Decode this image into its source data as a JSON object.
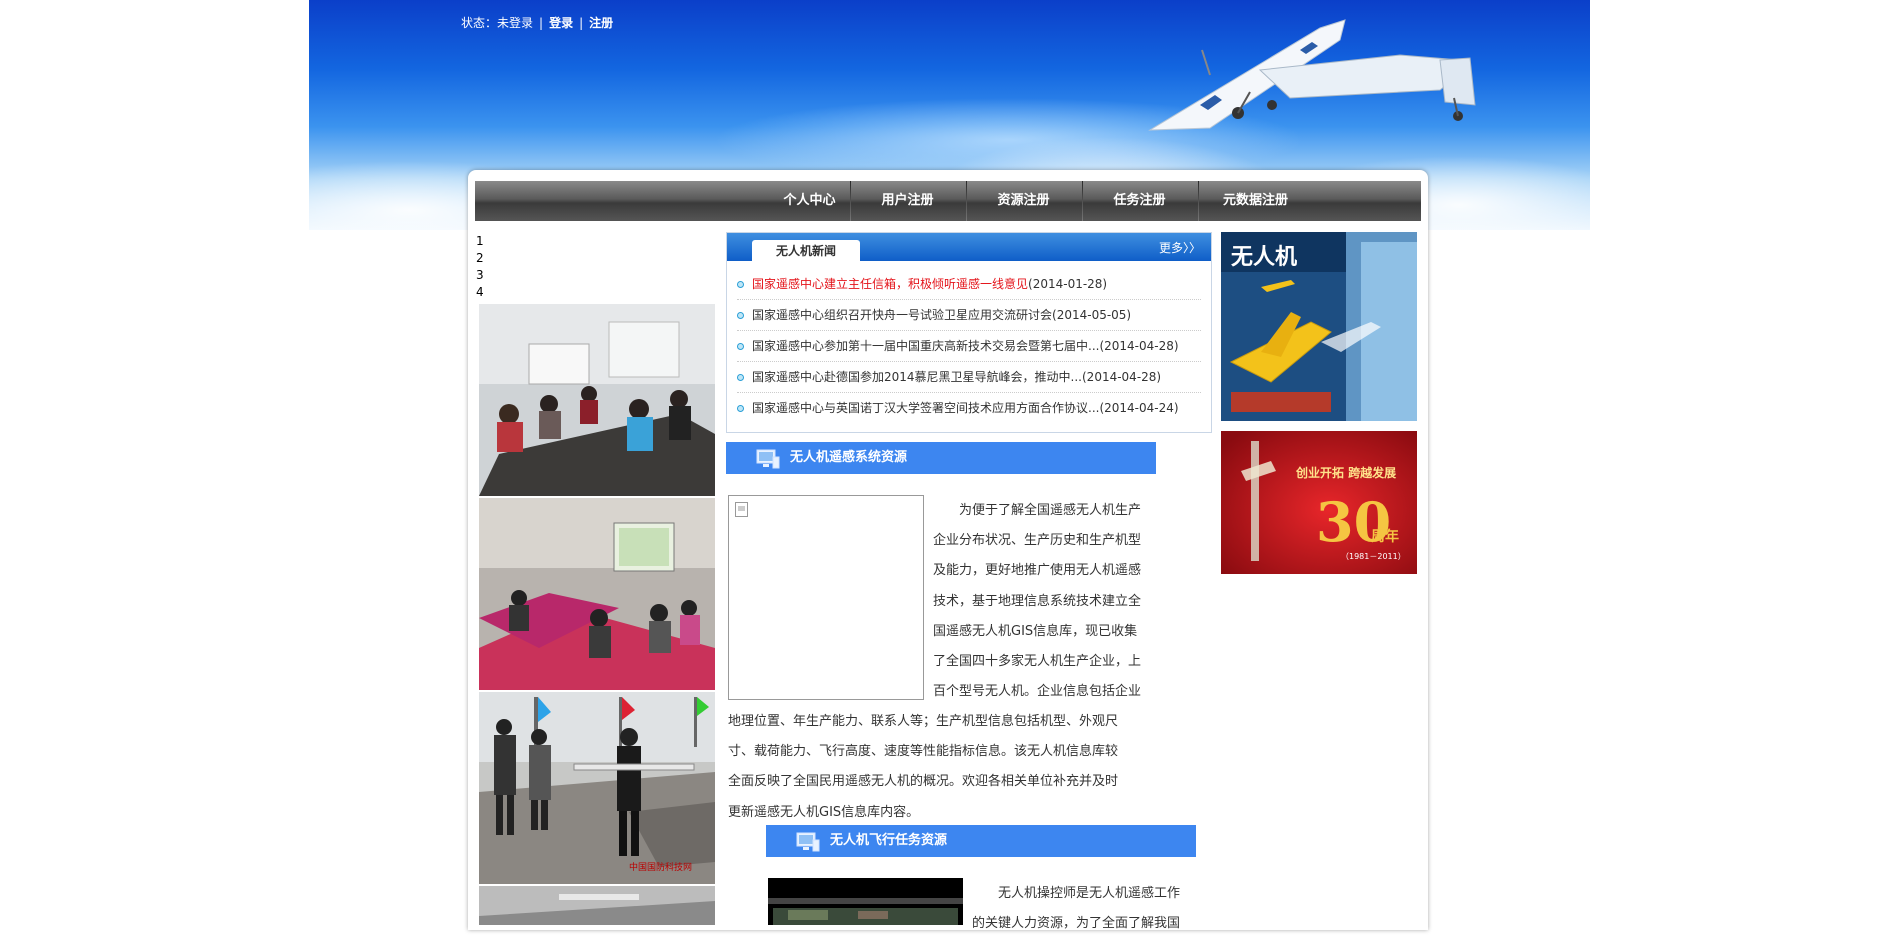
{
  "header": {
    "status_label": "状态：未登录",
    "login": "登录",
    "register": "注册"
  },
  "nav": {
    "items": [
      {
        "label": "个人中心"
      },
      {
        "label": "用户注册"
      },
      {
        "label": "资源注册"
      },
      {
        "label": "任务注册"
      },
      {
        "label": "元数据注册"
      }
    ]
  },
  "slider": {
    "numbers": [
      "1",
      "2",
      "3",
      "4"
    ]
  },
  "news": {
    "title": "无人机新闻",
    "more": "更多〉〉",
    "items": [
      {
        "title": "国家遥感中心建立主任信箱，积极倾听遥感一线意见",
        "date": "(2014-01-28)"
      },
      {
        "title": "国家遥感中心组织召开快舟一号试验卫星应用交流研讨会",
        "date": "(2014-05-05)"
      },
      {
        "title": "国家遥感中心参加第十一届中国重庆高新技术交易会暨第七届中...",
        "date": "(2014-04-28)"
      },
      {
        "title": "国家遥感中心赴德国参加2014慕尼黑卫星导航峰会，推动中...",
        "date": "(2014-04-28)"
      },
      {
        "title": "国家遥感中心与英国诺丁汉大学签署空间技术应用方面合作协议...",
        "date": "(2014-04-24)"
      }
    ]
  },
  "resources": {
    "title": "无人机遥感系统资源",
    "text_lines": [
      "　　为便于了解全国遥感无人机生产",
      "企业分布状况、生产历史和生产机型",
      "及能力，更好地推广使用无人机遥感",
      "技术，基于地理信息系统技术建立全",
      "国遥感无人机GIS信息库，现已收集",
      "了全国四十多家无人机生产企业，上",
      "百个型号无人机。企业信息包括企业"
    ],
    "text_full_lines": [
      "地理位置、年生产能力、联系人等；生产机型信息包括机型、外观尺",
      "寸、载荷能力、飞行高度、速度等性能指标信息。该无人机信息库较",
      "全面反映了全国民用遥感无人机的概况。欢迎各相关单位补充并及时",
      "更新遥感无人机GIS信息库内容。"
    ]
  },
  "tasks": {
    "title": "无人机飞行任务资源",
    "text_lines": [
      "　　无人机操控师是无人机遥感工作",
      "的关键人力资源，为了全面了解我国"
    ]
  },
  "sidebar": {
    "magazine_title": "无人机",
    "anniversary_slogan": "创业开拓 跨越发展",
    "anniversary_number": "30",
    "anniversary_unit": "周年",
    "anniversary_years": "（1981－2011）"
  },
  "colors": {
    "nav_bg": "#4a4a4a",
    "section_bar": "#3d86f0",
    "news_header": "#0f5ec8",
    "hot_news": "#e4141b"
  }
}
